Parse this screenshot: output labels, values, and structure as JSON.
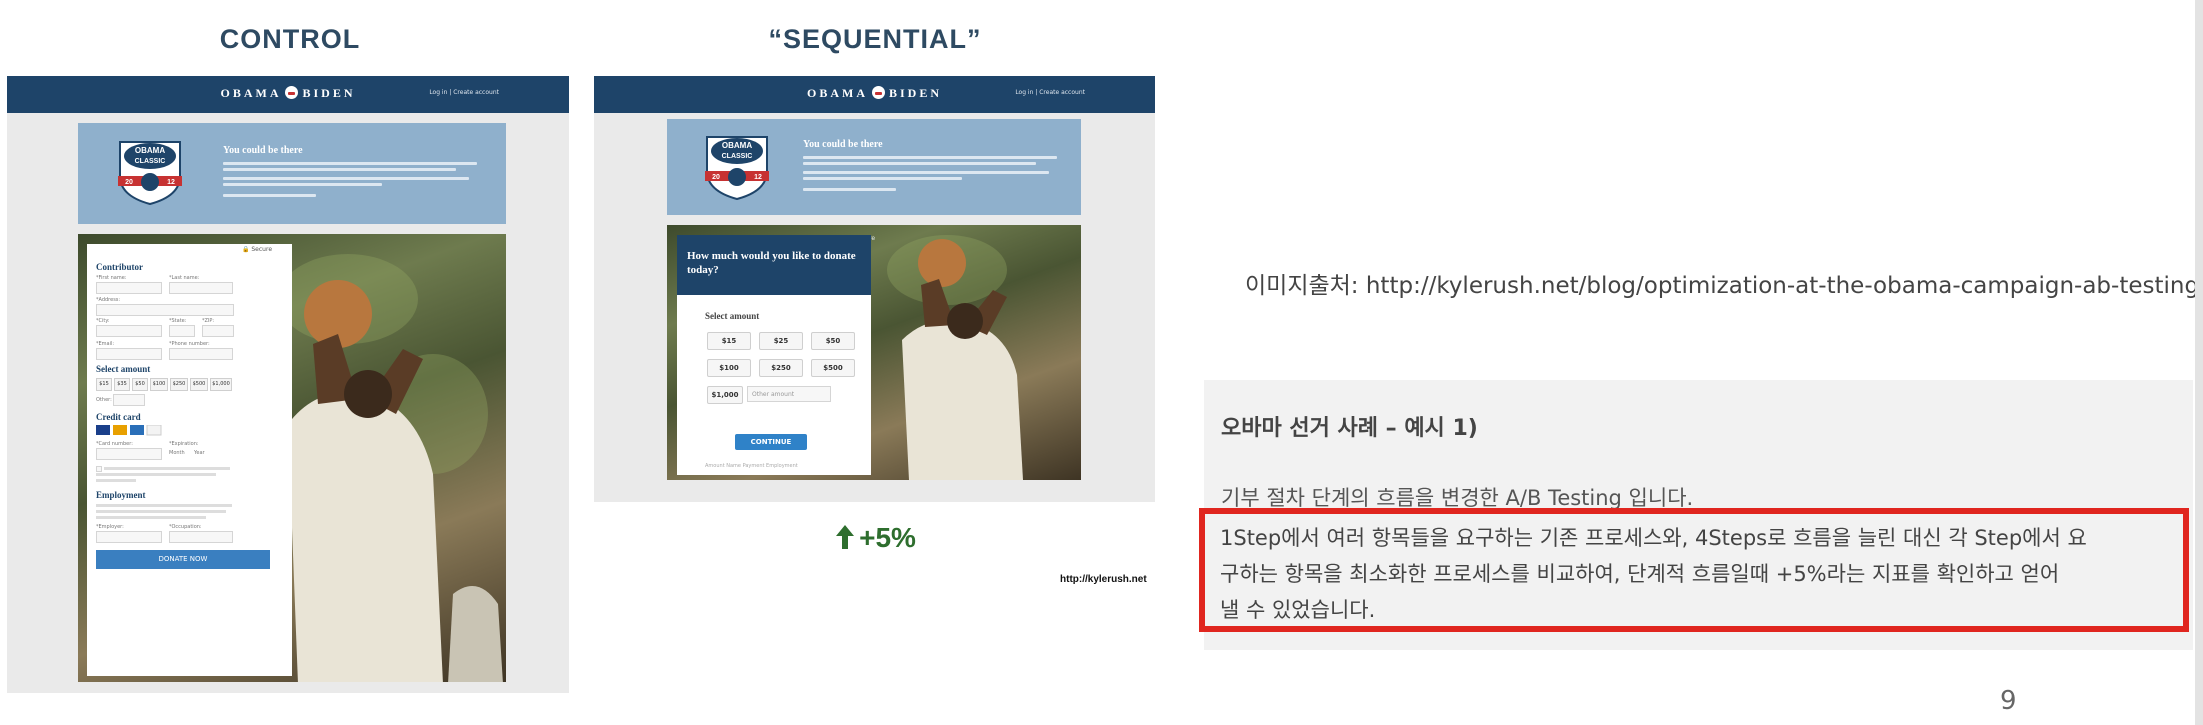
{
  "left": {
    "control_title": "CONTROL",
    "sequential_title": "“SEQUENTIAL”",
    "lift": "+5%",
    "small_source": "http://kylerush.net"
  },
  "mock": {
    "brand_left": "OBAMA",
    "brand_right": "BIDEN",
    "nav_links": "Log in  |  Create account",
    "banner_heading": "You could be there",
    "badge_top": "OBAMA",
    "badge_mid": "CLASSIC",
    "badge_left": "20",
    "badge_right": "12",
    "secure": "🔒 Secure",
    "control": {
      "contributor": "Contributor",
      "first_name": "*First name:",
      "last_name": "*Last name:",
      "address": "*Address:",
      "city": "*City:",
      "state": "*State:",
      "zip": "*ZIP:",
      "email": "*Email:",
      "phone": "*Phone number:",
      "select_amount": "Select amount",
      "amounts": [
        "$15",
        "$35",
        "$50",
        "$100",
        "$250",
        "$500",
        "$1,000"
      ],
      "other": "Other:",
      "credit_card": "Credit card",
      "card_number": "*Card number:",
      "expiration": "*Expiration:",
      "month": "Month",
      "year": "Year",
      "employment": "Employment",
      "employer": "*Employer:",
      "occupation": "*Occupation:",
      "donate_now": "DONATE NOW"
    },
    "sequential": {
      "question": "How much would you like to donate today?",
      "select_amount": "Select amount",
      "amounts": [
        "$15",
        "$25",
        "$50",
        "$100",
        "$250",
        "$500",
        "$1,000"
      ],
      "other_amount": "Other amount",
      "continue": "CONTINUE",
      "tabs": "Amount    Name    Payment    Employment"
    }
  },
  "right": {
    "image_source": "이미지출처: http://kylerush.net/blog/optimization-at-the-obama-campaign-ab-testing/",
    "panel_title": "오바마 선거 사례 – 예시 1)",
    "panel_line1": "기부 절차 단계의 흐름을 변경한 A/B Testing 입니다.",
    "highlight_line1": "1Step에서 여러 항목들을 요구하는 기존 프로세스와, 4Steps로 흐름을 늘린 대신 각 Step에서 요",
    "highlight_line2": "구하는 항목을 최소화한 프로세스를 비교하여, 단계적 흐름일때 +5%라는 지표를 확인하고 얻어",
    "highlight_line3": "낼 수 있었습니다."
  },
  "page_number": "9",
  "colors": {
    "navy": "#1e4469",
    "banner": "#8fb0cc",
    "highlight_border": "#e0261f",
    "lift_green": "#2e6e2e"
  }
}
